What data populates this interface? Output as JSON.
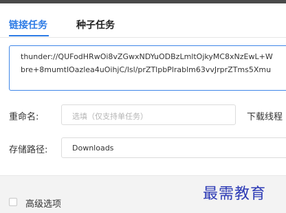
{
  "tabs": [
    {
      "label": "链接任务",
      "active": true
    },
    {
      "label": "种子任务",
      "active": false
    }
  ],
  "url_input": {
    "line1": "thunder://QUFodHRwOi8vZGwxNDYuODBzLmltOjkyMC8xNzEwL+W",
    "line2": "bre+8mumtlOazlea4uOihjC/lsl/prZTlpbPlrablm63vvJrprZTms5Xmu"
  },
  "rename": {
    "label": "重命名:",
    "placeholder": "选填（仅支持单任务）"
  },
  "threads": {
    "label": "下载线程"
  },
  "save_path": {
    "label": "存储路径:",
    "value": "Downloads"
  },
  "advanced": {
    "label": "高级选项",
    "checked": false
  },
  "watermark": "最需教育",
  "colors": {
    "accent": "#2d7be5",
    "watermark": "#2c3ab5"
  }
}
